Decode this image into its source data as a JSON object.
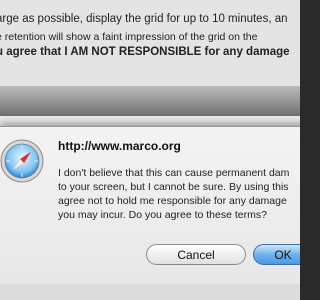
{
  "background_page": {
    "line1": "arge as possible, display the grid for up to 10 minutes, an",
    "line2": "e retention will show a faint impression of the grid on the",
    "line3": "u agree that I AM NOT RESPONSIBLE for any damage"
  },
  "dialog": {
    "icon": "safari-compass-icon",
    "url": "http://www.marco.org",
    "message": "I don't believe that this can cause permanent dam\nto your screen, but I cannot be sure. By using this\nagree not to hold me responsible for any damage\nyou may incur. Do you agree to these terms?",
    "cancel_label": "Cancel",
    "ok_label": "OK",
    "accent_color": "#4a98e3"
  }
}
